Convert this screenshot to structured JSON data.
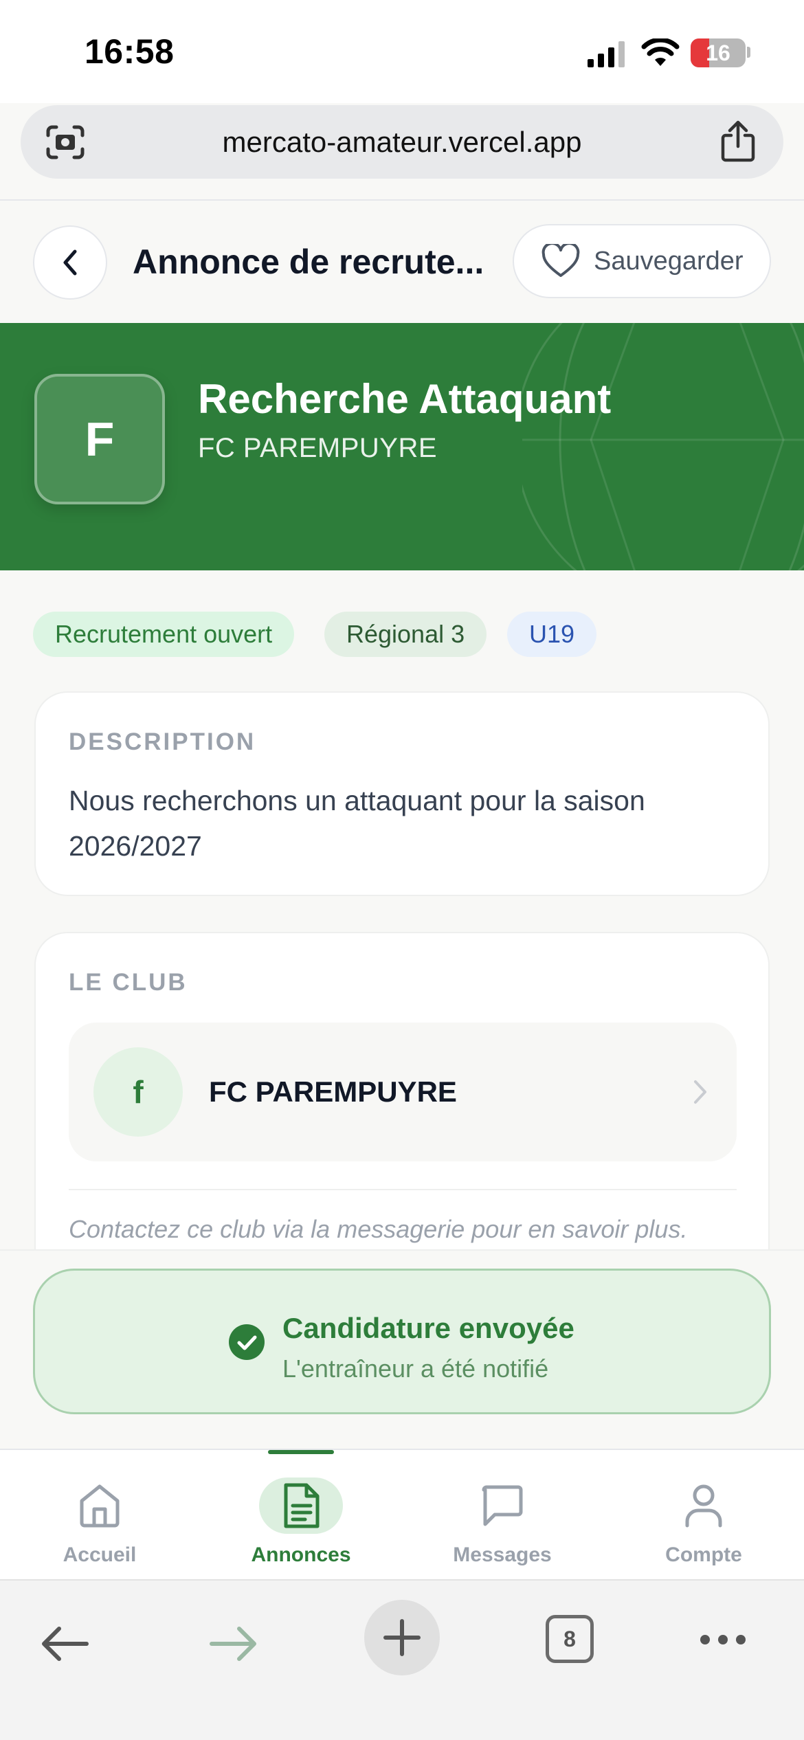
{
  "status_bar": {
    "time": "16:58",
    "battery": "16"
  },
  "browser": {
    "url": "mercato-amateur.vercel.app",
    "tab_count": "8"
  },
  "header": {
    "title": "Annonce de recrute...",
    "save_label": "Sauvegarder"
  },
  "banner": {
    "logo_letter": "F",
    "title": "Recherche Attaquant",
    "club": "FC PAREMPUYRE"
  },
  "chips": {
    "status": "Recrutement ouvert",
    "level": "Régional 3",
    "category": "U19"
  },
  "description": {
    "label": "DESCRIPTION",
    "text": "Nous recherchons un attaquant pour la saison 2026/2027"
  },
  "club": {
    "label": "LE CLUB",
    "logo_letter": "f",
    "name": "FC PAREMPUYRE",
    "note": "Contactez ce club via la messagerie pour en savoir plus."
  },
  "application": {
    "title": "Candidature envoyée",
    "subtitle": "L'entraîneur a été notifié"
  },
  "tabbar": {
    "items": [
      {
        "label": "Accueil",
        "icon": "home-icon"
      },
      {
        "label": "Annonces",
        "icon": "document-icon"
      },
      {
        "label": "Messages",
        "icon": "message-icon"
      },
      {
        "label": "Compte",
        "icon": "user-icon"
      }
    ],
    "active": "Annonces"
  },
  "colors": {
    "brand_green": "#2d7d3a",
    "page_bg": "#f8f8f6"
  }
}
